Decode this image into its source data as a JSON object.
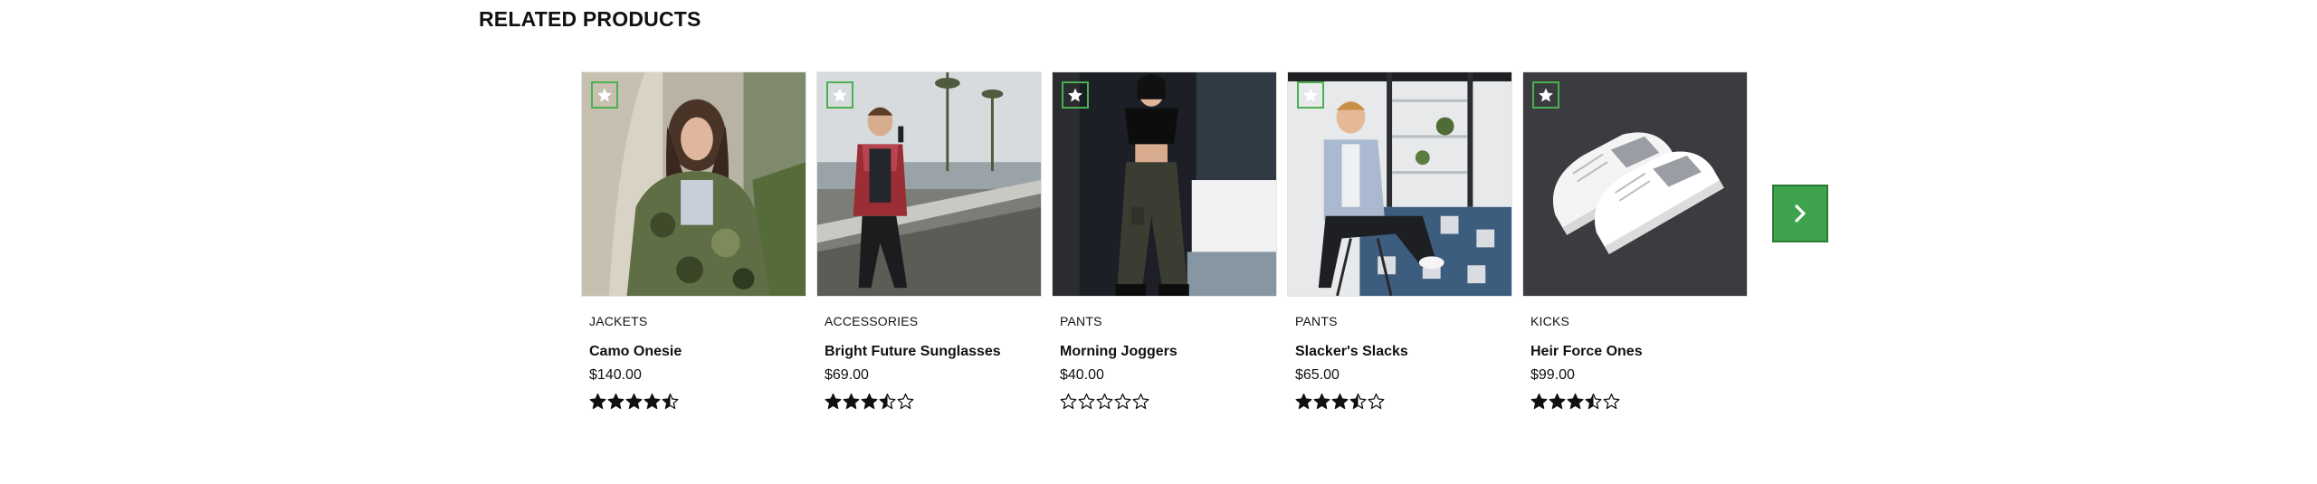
{
  "section": {
    "title": "RELATED PRODUCTS"
  },
  "colors": {
    "accent": "#3fa34d",
    "accent_dark": "#2b7a35"
  },
  "products": [
    {
      "category": "JACKETS",
      "name": "Camo Onesie",
      "price": "$140.00",
      "rating": 4.5,
      "image_icon": "photo-camo-jacket"
    },
    {
      "category": "ACCESSORIES",
      "name": "Bright Future Sunglasses",
      "price": "$69.00",
      "rating": 3.5,
      "image_icon": "photo-sunglasses-man"
    },
    {
      "category": "PANTS",
      "name": "Morning Joggers",
      "price": "$40.00",
      "rating": 0,
      "image_icon": "photo-joggers"
    },
    {
      "category": "PANTS",
      "name": "Slacker's Slacks",
      "price": "$65.00",
      "rating": 3.5,
      "image_icon": "photo-slacks-man"
    },
    {
      "category": "KICKS",
      "name": "Heir Force Ones",
      "price": "$99.00",
      "rating": 3.5,
      "image_icon": "photo-white-sneakers"
    }
  ],
  "carousel": {
    "next_icon": "chevron-right-icon"
  }
}
